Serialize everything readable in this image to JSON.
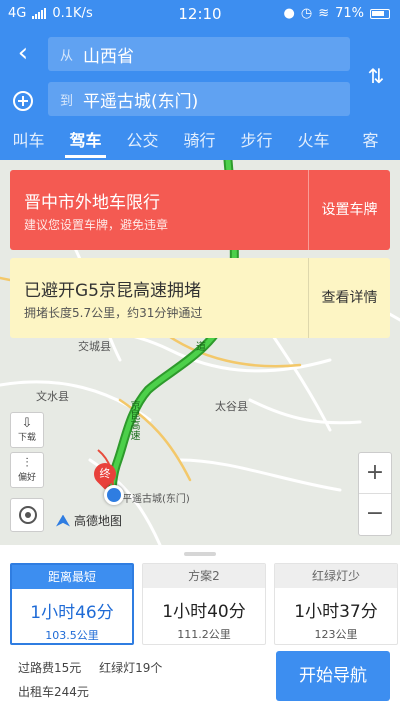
{
  "status_bar": {
    "network": "4G",
    "speed": "0.1K/s",
    "time": "12:10",
    "battery": "71%"
  },
  "route": {
    "from_tag": "从",
    "from": "山西省",
    "to_tag": "到",
    "to": "平遥古城(东门)"
  },
  "tabs": [
    {
      "label": "叫车",
      "active": false
    },
    {
      "label": "驾车",
      "active": true
    },
    {
      "label": "公交",
      "active": false
    },
    {
      "label": "骑行",
      "active": false
    },
    {
      "label": "步行",
      "active": false
    },
    {
      "label": "火车",
      "active": false
    },
    {
      "label": "客",
      "active": false
    }
  ],
  "alerts": {
    "restriction": {
      "title": "晋中市外地车限行",
      "subtitle": "建议您设置车牌，避免违章",
      "action": "设置车牌"
    },
    "traffic": {
      "title": "已避开G5京昆高速拥堵",
      "subtitle": "拥堵长度5.7公里，约31分钟通过",
      "action": "查看详情"
    }
  },
  "map": {
    "labels": {
      "jiaocheng": "交城县",
      "wenshui": "文水县",
      "taigu": "太谷县",
      "destination": "平遥古城(东门)",
      "highway_vertical": "京昆高速",
      "highway_top": "道",
      "end_marker": "终"
    },
    "controls": {
      "download": "下载",
      "preference": "偏好"
    },
    "zoom_in": "+",
    "zoom_out": "−",
    "logo": "高德地图",
    "colors": {
      "route": "#3dba3a",
      "end_marker": "#e8413b",
      "location": "#2f7de1"
    }
  },
  "plans": [
    {
      "header": "距离最短",
      "time": "1小时46分",
      "distance": "103.5公里",
      "selected": true
    },
    {
      "header": "方案2",
      "time": "1小时40分",
      "distance": "111.2公里",
      "selected": false
    },
    {
      "header": "红绿灯少",
      "time": "1小时37分",
      "distance": "123公里",
      "selected": false
    }
  ],
  "trip_info": {
    "toll": "过路费15元",
    "lights": "红绿灯19个",
    "taxi": "出租车244元"
  },
  "start_button": "开始导航"
}
